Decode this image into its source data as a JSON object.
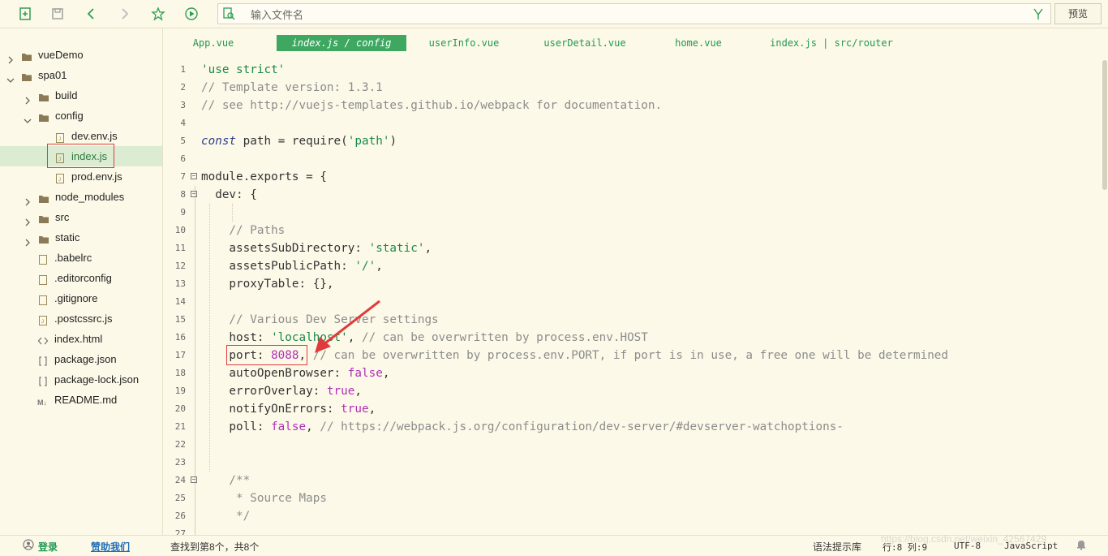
{
  "toolbar": {
    "search_placeholder": "输入文件名",
    "preview_label": "预览",
    "icons": [
      "new-file-icon",
      "save-icon",
      "back-icon",
      "forward-icon",
      "star-icon",
      "run-icon",
      "find-file-icon",
      "filter-icon"
    ]
  },
  "sidebar": {
    "items": [
      {
        "label": "vueDemo"
      },
      {
        "label": "spa01"
      },
      {
        "label": "build"
      },
      {
        "label": "config"
      },
      {
        "label": "dev.env.js"
      },
      {
        "label": "index.js"
      },
      {
        "label": "prod.env.js"
      },
      {
        "label": "node_modules"
      },
      {
        "label": "src"
      },
      {
        "label": "static"
      },
      {
        "label": ".babelrc"
      },
      {
        "label": ".editorconfig"
      },
      {
        "label": ".gitignore"
      },
      {
        "label": ".postcssrc.js"
      },
      {
        "label": "index.html"
      },
      {
        "label": "package.json"
      },
      {
        "label": "package-lock.json"
      },
      {
        "label": "README.md"
      }
    ]
  },
  "tabs": [
    {
      "label": "App.vue"
    },
    {
      "label": "index.js / config"
    },
    {
      "label": "userInfo.vue"
    },
    {
      "label": "userDetail.vue"
    },
    {
      "label": "home.vue"
    },
    {
      "label": "index.js | src/router"
    }
  ],
  "code": {
    "lines": [
      "1",
      "2",
      "3",
      "4",
      "5",
      "6",
      "7",
      "8",
      "9",
      "10",
      "11",
      "12",
      "13",
      "14",
      "15",
      "16",
      "17",
      "18",
      "19",
      "20",
      "21",
      "22",
      "23",
      "24",
      "25",
      "26",
      "27"
    ],
    "l1": "'use strict'",
    "l2": "// Template version: 1.3.1",
    "l3": "// see http://vuejs-templates.github.io/webpack for documentation.",
    "l5_kw": "const",
    "l5_rest": " path = require(",
    "l5_str": "'path'",
    "l5_end": ")",
    "l7": "module.exports = {",
    "l8": "  dev: {",
    "l10": "    // Paths",
    "l11_a": "    assetsSubDirectory: ",
    "l11_s": "'static'",
    "l11_e": ",",
    "l12_a": "    assetsPublicPath: ",
    "l12_s": "'/'",
    "l12_e": ",",
    "l13": "    proxyTable: {},",
    "l15": "    // Various Dev Server settings",
    "l16_a": "    host: ",
    "l16_s": "'localhost'",
    "l16_e": ", ",
    "l16_c": "// can be overwritten by process.env.HOST",
    "l17_a": "    port: ",
    "l17_n": "8088",
    "l17_e": ", ",
    "l17_c": "// can be overwritten by process.env.PORT, if port is in use, a free one will be determined",
    "l18_a": "    autoOpenBrowser: ",
    "l18_b": "false",
    "l18_e": ",",
    "l19_a": "    errorOverlay: ",
    "l19_b": "true",
    "l19_e": ",",
    "l20_a": "    notifyOnErrors: ",
    "l20_b": "true",
    "l20_e": ",",
    "l21_a": "    poll: ",
    "l21_b": "false",
    "l21_e": ", ",
    "l21_c": "// https://webpack.js.org/configuration/dev-server/#devserver-watchoptions-",
    "l24": "    /**",
    "l25": "     * Source Maps",
    "l26": "     */"
  },
  "status": {
    "login": "登录",
    "sponsor": "赞助我们",
    "find_result": "查找到第8个，共8个",
    "syntax_hint": "语法提示库",
    "position": "行:8  列:9",
    "encoding": "UTF-8",
    "language": "JavaScript",
    "watermark": "https://blog.csdn.net/weixin_42567429"
  },
  "colors": {
    "background": "#fdf9e8",
    "accent_green": "#3ea861",
    "highlight_red": "#e03b3b"
  }
}
